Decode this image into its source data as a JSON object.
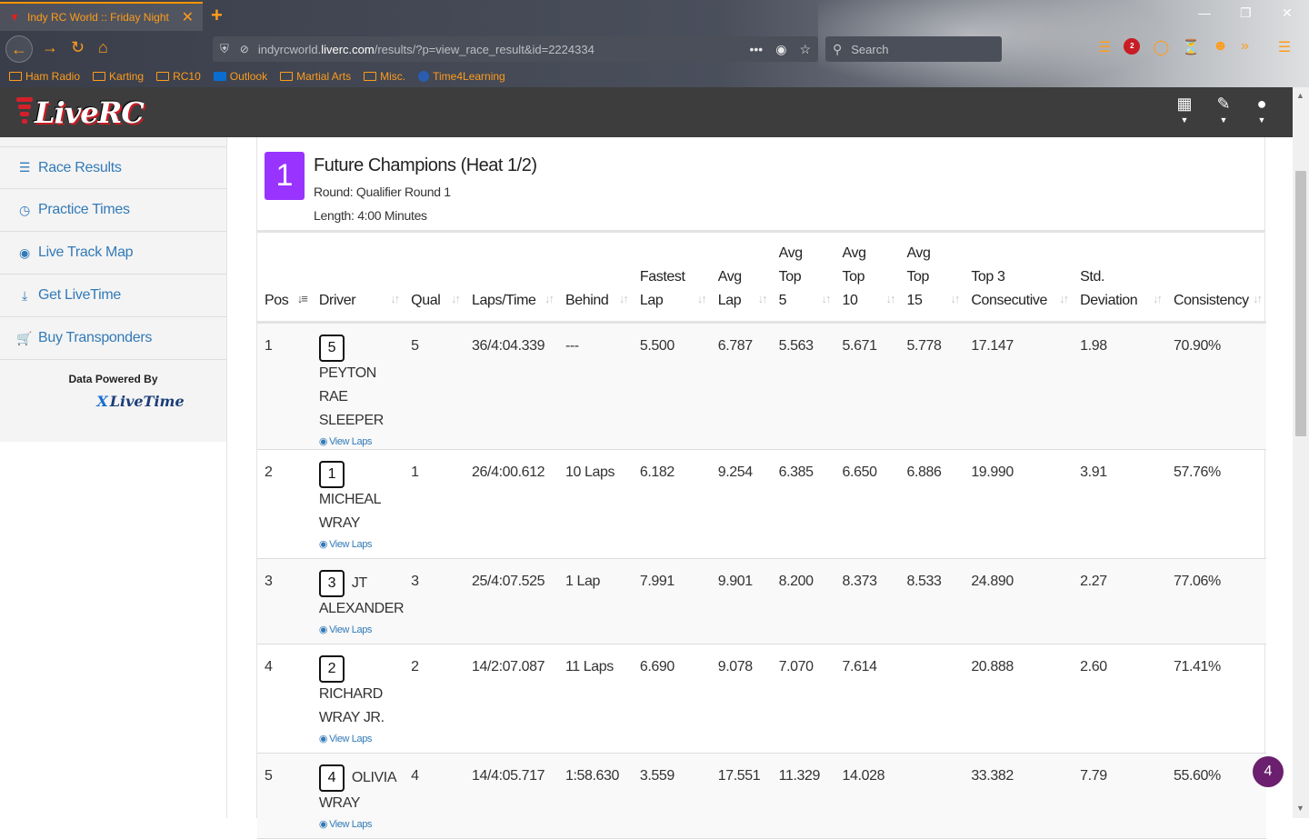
{
  "browser": {
    "tab_title": "Indy RC World :: Friday Night",
    "url_host": "indyrcworld.",
    "url_domain": "liverc.com",
    "url_path": "/results/?p=view_race_result&id=2224334",
    "search_placeholder": "Search",
    "abp_count": "2",
    "bookmarks": [
      "Ham Radio",
      "Karting",
      "RC10",
      "Outlook",
      "Martial Arts",
      "Misc.",
      "Time4Learning"
    ]
  },
  "site": {
    "logo_text": "LiveRC"
  },
  "sidebar": {
    "items": [
      {
        "label": "Race Results",
        "icon": "list-icon"
      },
      {
        "label": "Practice Times",
        "icon": "clock-icon"
      },
      {
        "label": "Live Track Map",
        "icon": "globe-icon"
      },
      {
        "label": "Get LiveTime",
        "icon": "download-icon"
      },
      {
        "label": "Buy Transponders",
        "icon": "cart-icon"
      }
    ],
    "powered_by": "Data Powered By",
    "powered_logo": "LiveTime"
  },
  "race": {
    "number": "1",
    "title": "Future Champions (Heat 1/2)",
    "round": "Round: Qualifier Round 1",
    "length": "Length: 4:00 Minutes"
  },
  "table": {
    "headers": {
      "pos": "Pos",
      "driver": "Driver",
      "qual": "Qual",
      "laps": "Laps/Time",
      "behind": "Behind",
      "fastest_1": "Fastest",
      "fastest_2": "Lap",
      "avglap_1": "Avg",
      "avglap_2": "Lap",
      "top5_1": "Avg",
      "top5_2": "Top",
      "top5_3": "5",
      "top10_1": "Avg",
      "top10_2": "Top",
      "top10_3": "10",
      "top15_1": "Avg",
      "top15_2": "Top",
      "top15_3": "15",
      "top3c_1": "Top 3",
      "top3c_2": "Consecutive",
      "std_1": "Std.",
      "std_2": "Deviation",
      "consistency": "Consistency"
    },
    "view_laps": "View Laps",
    "rows": [
      {
        "pos": "1",
        "car": "5",
        "name": "PEYTON RAE SLEEPER",
        "qual": "5",
        "laps": "36/4:04.339",
        "behind": "---",
        "fastest": "5.500",
        "avg": "6.787",
        "top5": "5.563",
        "top10": "5.671",
        "top15": "5.778",
        "top3c": "17.147",
        "std": "1.98",
        "cons": "70.90%"
      },
      {
        "pos": "2",
        "car": "1",
        "name": "MICHEAL WRAY",
        "qual": "1",
        "laps": "26/4:00.612",
        "behind": "10 Laps",
        "fastest": "6.182",
        "avg": "9.254",
        "top5": "6.385",
        "top10": "6.650",
        "top15": "6.886",
        "top3c": "19.990",
        "std": "3.91",
        "cons": "57.76%"
      },
      {
        "pos": "3",
        "car": "3",
        "name": "JT ALEXANDER",
        "qual": "3",
        "laps": "25/4:07.525",
        "behind": "1 Lap",
        "fastest": "7.991",
        "avg": "9.901",
        "top5": "8.200",
        "top10": "8.373",
        "top15": "8.533",
        "top3c": "24.890",
        "std": "2.27",
        "cons": "77.06%"
      },
      {
        "pos": "4",
        "car": "2",
        "name": "RICHARD WRAY JR.",
        "qual": "2",
        "laps": "14/2:07.087",
        "behind": "11 Laps",
        "fastest": "6.690",
        "avg": "9.078",
        "top5": "7.070",
        "top10": "7.614",
        "top15": "",
        "top3c": "20.888",
        "std": "2.60",
        "cons": "71.41%"
      },
      {
        "pos": "5",
        "car": "4",
        "name": "OLIVIA WRAY",
        "qual": "4",
        "laps": "14/4:05.717",
        "behind": "1:58.630",
        "fastest": "3.559",
        "avg": "17.551",
        "top5": "11.329",
        "top10": "14.028",
        "top15": "",
        "top3c": "33.382",
        "std": "7.79",
        "cons": "55.60%"
      }
    ]
  },
  "chat_badge": "4"
}
